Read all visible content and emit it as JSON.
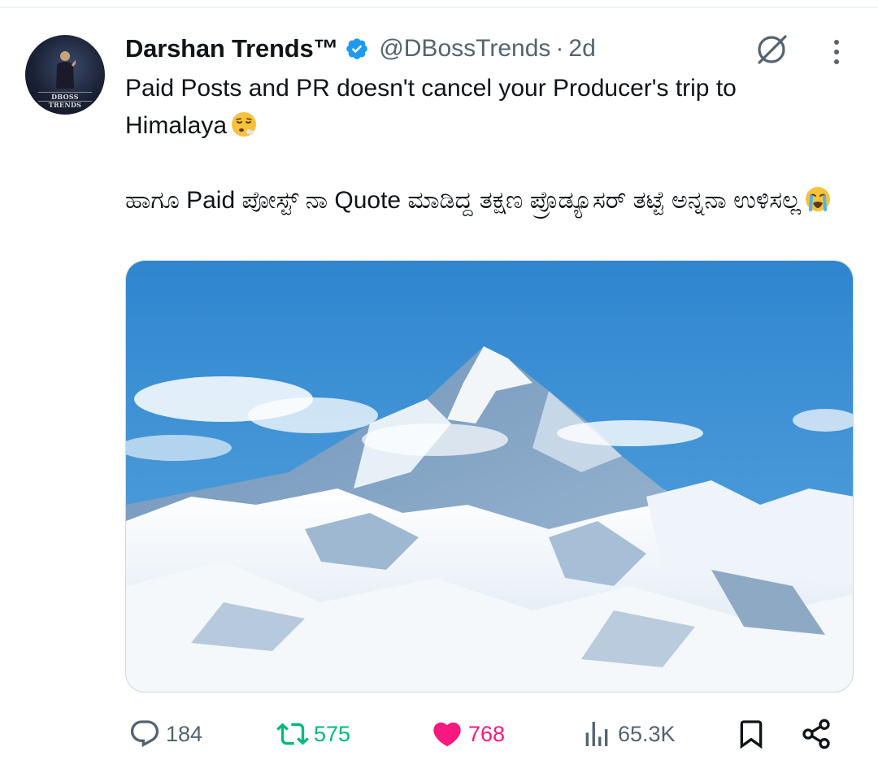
{
  "tweet": {
    "display_name": "Darshan Trends™",
    "handle": "@DBossTrends",
    "separator": "·",
    "time": "2d",
    "avatar_text": "DBOSS TRENDS",
    "text_line1": "Paid Posts and PR doesn't cancel your Producer's trip to Himalaya",
    "text_line2": "ಹಾಗೂ Paid ಪೋಸ್ಟ್ ನಾ Quote ಮಾಡಿದ್ದ ತಕ್ಷಣ ಪ್ರೊಡ್ಯೂಸರ್ ತಟ್ಟೆ ಅನ್ನನಾ ಉಳಿಸಲ್ಲ",
    "emoji1": "face-exhaling-emoji",
    "emoji2": "loudly-crying-face-emoji"
  },
  "actions": {
    "replies": "184",
    "retweets": "575",
    "likes": "768",
    "views": "65.3K"
  },
  "colors": {
    "verified": "#1d9bf0",
    "retweet_active": "#00ba7c",
    "like_active": "#f91880",
    "secondary_text": "#536471",
    "sky": "#3a8fd1"
  },
  "icons": [
    "verified-badge-icon",
    "grok-icon",
    "more-options-icon",
    "reply-icon",
    "retweet-icon",
    "like-icon",
    "views-icon",
    "bookmark-icon",
    "share-icon"
  ]
}
